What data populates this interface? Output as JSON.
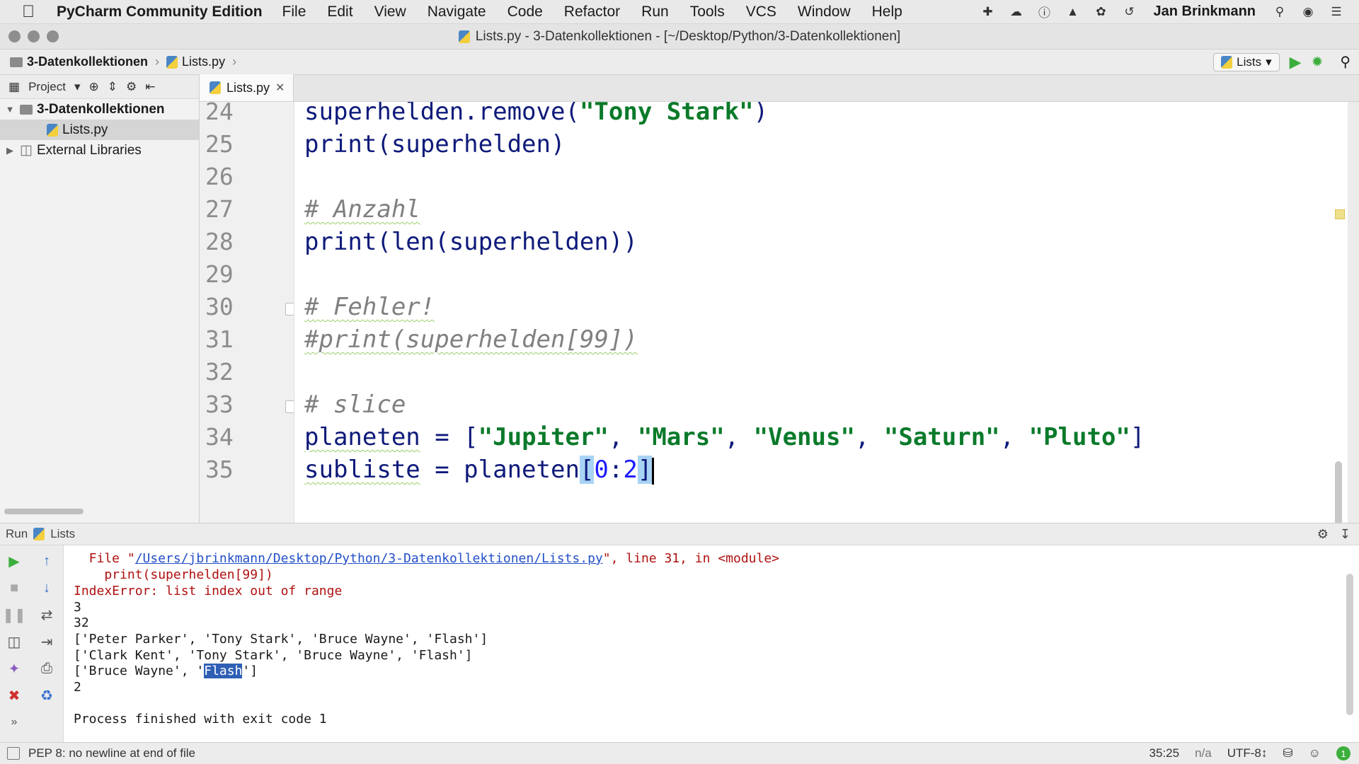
{
  "menubar": {
    "app_name": "PyCharm Community Edition",
    "items": [
      "File",
      "Edit",
      "View",
      "Navigate",
      "Code",
      "Refactor",
      "Run",
      "Tools",
      "VCS",
      "Window",
      "Help"
    ],
    "user": "Jan Brinkmann"
  },
  "window": {
    "title": "Lists.py - 3-Datenkollektionen - [~/Desktop/Python/3-Datenkollektionen]"
  },
  "navbar": {
    "breadcrumb": [
      "3-Datenkollektionen",
      "Lists.py"
    ],
    "run_config": "Lists"
  },
  "project_panel": {
    "label": "Project",
    "tree": [
      {
        "label": "3-Datenkollektionen"
      },
      {
        "label": "Lists.py"
      },
      {
        "label": "External Libraries"
      }
    ]
  },
  "editor": {
    "tab": "Lists.py",
    "lines": [
      {
        "n": "24"
      },
      {
        "n": "25"
      },
      {
        "n": "26"
      },
      {
        "n": "27"
      },
      {
        "n": "28"
      },
      {
        "n": "29"
      },
      {
        "n": "30"
      },
      {
        "n": "31"
      },
      {
        "n": "32"
      },
      {
        "n": "33"
      },
      {
        "n": "34"
      },
      {
        "n": "35"
      }
    ],
    "code": {
      "l24a": "superhelden.remove(",
      "l24b": "\"Tony Stark\"",
      "l24c": ")",
      "l25": "print(superhelden)",
      "l27": "# Anzahl",
      "l28": "print(len(superhelden))",
      "l30": "# Fehler!",
      "l31": "#print(superhelden[99])",
      "l33": "# slice",
      "l34a": "planeten",
      " l34b": "",
      "l34_eq": " = [",
      "l34_s1": "\"Jupiter\"",
      "l34_s2": "\"Mars\"",
      "l34_s3": "\"Venus\"",
      "l34_s4": "\"Saturn\"",
      "l34_s5": "\"Pluto\"",
      "l34_end": "]",
      "comma": ", ",
      "l35a": "subliste",
      "l35b": " = planeten",
      "l35c": "[",
      "l35d": "0",
      "l35e": ":",
      "l35f": "2",
      "l35g": "]"
    }
  },
  "run_panel": {
    "label": "Run",
    "config": "Lists",
    "output": {
      "o1a": "  File \"",
      "o1b": "/Users/jbrinkmann/Desktop/Python/3-Datenkollektionen/Lists.py",
      "o1c": "\", line 31, in <module>",
      "o2": "    print(superhelden[99])",
      "o3": "IndexError: list index out of range",
      "o4": "3",
      "o5": "32",
      "o6": "['Peter Parker', 'Tony Stark', 'Bruce Wayne', 'Flash']",
      "o7": "['Clark Kent', 'Tony Stark', 'Bruce Wayne', 'Flash']",
      "o8a": "['Bruce Wayne', '",
      "o8b": "Flash",
      "o8c": "']",
      "o9": "2",
      "o10": "Process finished with exit code 1"
    }
  },
  "statusbar": {
    "message": "PEP 8: no newline at end of file",
    "position": "35:25",
    "na": "n/a",
    "encoding": "UTF-8↕",
    "badge": "1"
  },
  "icons": [
    "apple-icon",
    "plus-icon",
    "cloud-icon",
    "info-icon",
    "ghost-icon",
    "leaf-icon",
    "history-icon",
    "search-icon",
    "siri-icon",
    "list-icon"
  ]
}
